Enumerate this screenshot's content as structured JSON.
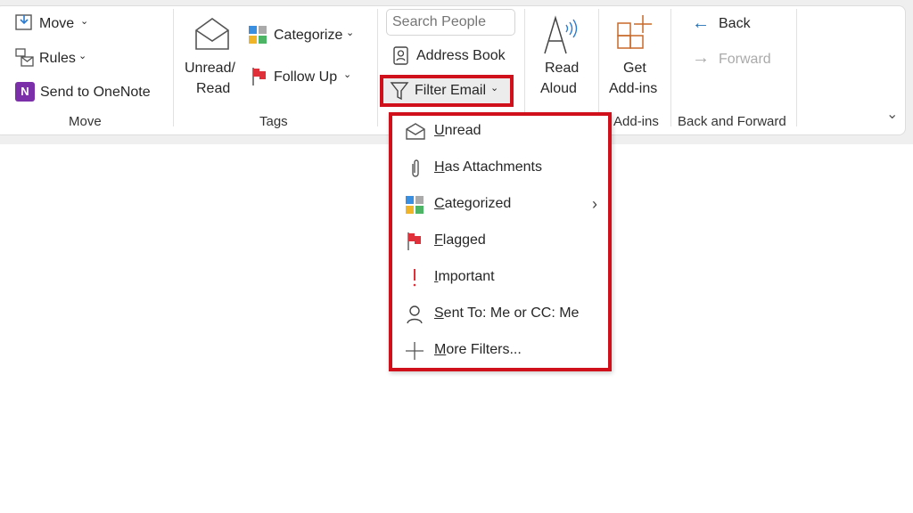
{
  "ribbon": {
    "move_group": {
      "move": "Move",
      "rules": "Rules",
      "onenote": "Send to OneNote",
      "label": "Move"
    },
    "tags_group": {
      "unread_read_1": "Unread/",
      "unread_read_2": "Read",
      "categorize": "Categorize",
      "follow_up": "Follow Up",
      "label": "Tags"
    },
    "find_group": {
      "search_placeholder": "Search People",
      "address_book": "Address Book",
      "filter_email": "Filter Email"
    },
    "speech": {
      "read_1": "Read",
      "read_2": "Aloud"
    },
    "addins": {
      "get_1": "Get",
      "get_2": "Add-ins",
      "label": "Add-ins"
    },
    "nav": {
      "back": "Back",
      "forward": "Forward",
      "label": "Back and Forward"
    }
  },
  "filter_menu": {
    "items": [
      {
        "label": "Unread",
        "icon": "envelope-open-icon"
      },
      {
        "label": "Has Attachments",
        "icon": "paperclip-icon"
      },
      {
        "label": "Categorized",
        "icon": "categories-icon",
        "submenu": true
      },
      {
        "label": "Flagged",
        "icon": "flag-icon"
      },
      {
        "label": "Important",
        "icon": "exclamation-icon"
      },
      {
        "label": "Sent To: Me or CC: Me",
        "icon": "person-icon"
      },
      {
        "label": "More Filters...",
        "icon": "plus-icon"
      }
    ]
  },
  "colors": {
    "highlight": "#d0101a",
    "flag": "#e0303a",
    "back_arrow": "#1f6fb5",
    "addins": "#c8692a"
  }
}
